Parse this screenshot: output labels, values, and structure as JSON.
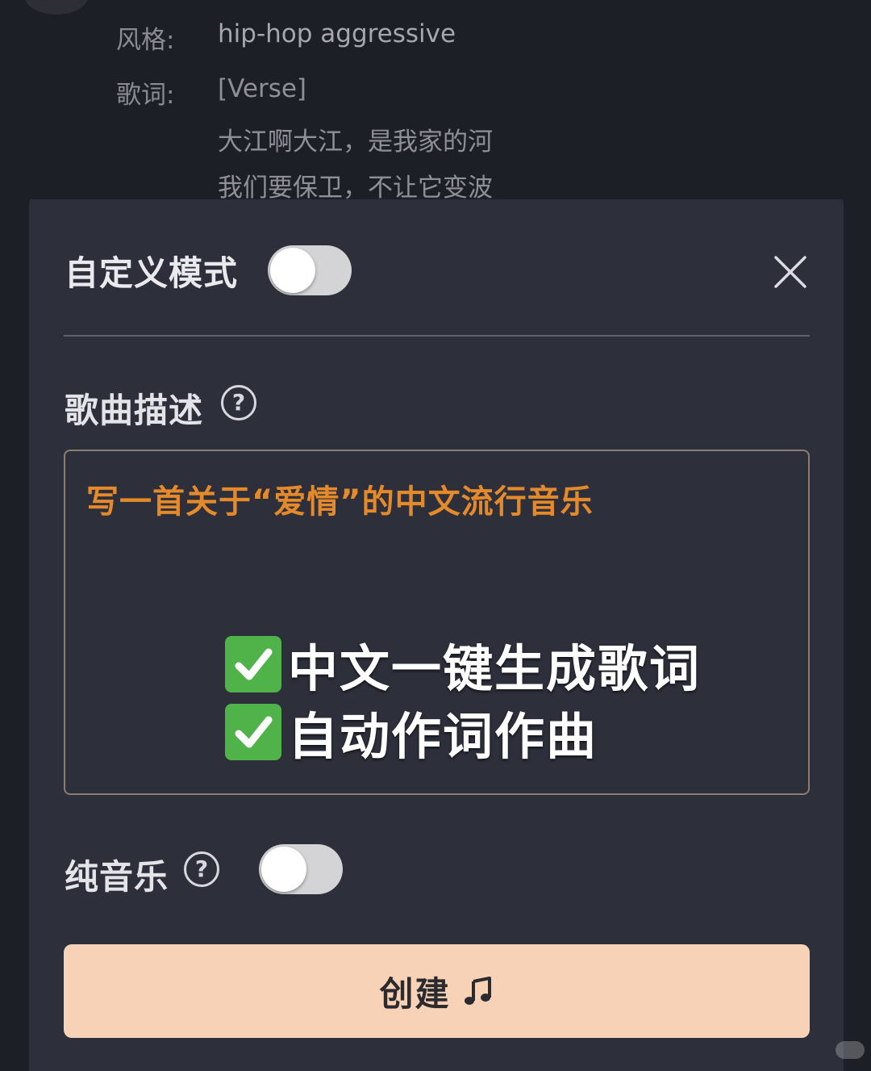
{
  "background_song": {
    "style_label": "风格:",
    "style_value": "hip-hop aggressive",
    "lyrics_label": "歌词:",
    "lyrics_lines": [
      "[Verse]",
      "大江啊大江，是我家的河",
      "我们要保卫，不让它变波"
    ]
  },
  "dialog": {
    "title": "自定义模式",
    "custom_mode_on": false,
    "close_icon": "close-icon",
    "description_label": "歌曲描述",
    "help_symbol": "?",
    "description_text": "写一首关于“爱情”的中文流行音乐",
    "overlay_lines": [
      "中文一键生成歌词",
      "自动作词作曲"
    ],
    "instrumental_label": "纯音乐",
    "instrumental_on": false,
    "create_label": "创建",
    "create_icon": "music-note-icon"
  },
  "colors": {
    "panel": "#2d2f3b",
    "accent_text": "#e58a2a",
    "button": "#f7d2b6",
    "check": "#4fb34a"
  }
}
